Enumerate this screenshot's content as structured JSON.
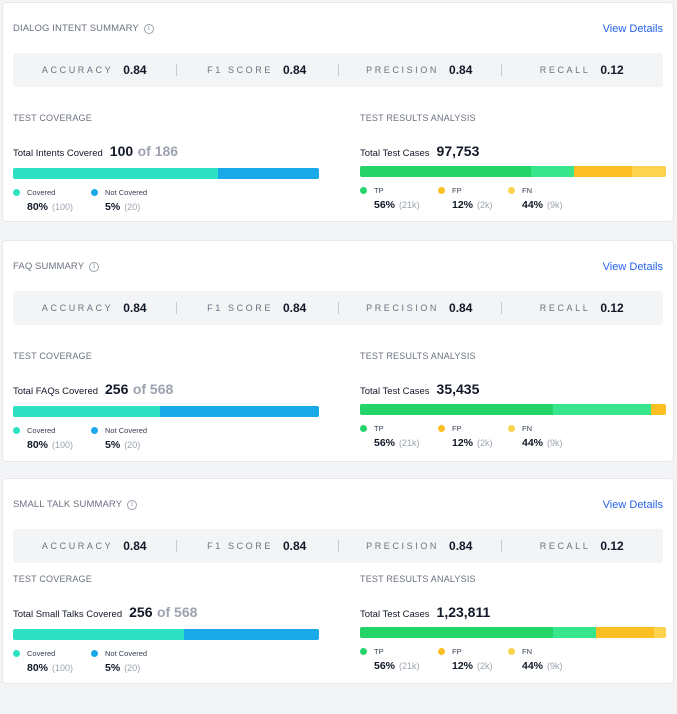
{
  "colors": {
    "covered": "#2de2c3",
    "not_covered": "#1aa9e8",
    "tp_dark": "#24d468",
    "tp_light": "#39e58a",
    "fp": "#fbbf24",
    "fn": "#fcd34d",
    "link": "#2563eb"
  },
  "cards": [
    {
      "title": "DIALOG INTENT SUMMARY",
      "view_details": "View Details",
      "metrics": [
        {
          "label": "ACCURACY",
          "value": "0.84"
        },
        {
          "label": "F1 SCORE",
          "value": "0.84"
        },
        {
          "label": "PRECISION",
          "value": "0.84"
        },
        {
          "label": "RECALL",
          "value": "0.12"
        }
      ],
      "coverage": {
        "title": "TEST COVERAGE",
        "total_label": "Total Intents Covered",
        "total_value": "100",
        "total_of": "of 186",
        "bar": [
          0.67,
          0.33
        ],
        "legend": [
          {
            "label": "Covered",
            "value": "80%",
            "sub": "(100)",
            "color": "#2de2c3"
          },
          {
            "label": "Not Covered",
            "value": "5%",
            "sub": "(20)",
            "color": "#1aa9e8"
          }
        ]
      },
      "results": {
        "title": "TEST RESULTS ANALYSIS",
        "total_label": "Total Test Cases",
        "total_value": "97,753",
        "bar": [
          0.56,
          0.14,
          0.19,
          0.11
        ],
        "legend": [
          {
            "label": "TP",
            "value": "56%",
            "sub": "(21k)",
            "color": "#24d468"
          },
          {
            "label": "FP",
            "value": "12%",
            "sub": "(2k)",
            "color": "#fbbf24"
          },
          {
            "label": "FN",
            "value": "44%",
            "sub": "(9k)",
            "color": "#fcd34d"
          }
        ]
      }
    },
    {
      "title": "FAQ SUMMARY",
      "view_details": "View Details",
      "metrics": [
        {
          "label": "ACCURACY",
          "value": "0.84"
        },
        {
          "label": "F1 SCORE",
          "value": "0.84"
        },
        {
          "label": "PRECISION",
          "value": "0.84"
        },
        {
          "label": "RECALL",
          "value": "0.12"
        }
      ],
      "coverage": {
        "title": "TEST COVERAGE",
        "total_label": "Total FAQs Covered",
        "total_value": "256",
        "total_of": "of 568",
        "bar": [
          0.48,
          0.52
        ],
        "legend": [
          {
            "label": "Covered",
            "value": "80%",
            "sub": "(100)",
            "color": "#2de2c3"
          },
          {
            "label": "Not Covered",
            "value": "5%",
            "sub": "(20)",
            "color": "#1aa9e8"
          }
        ]
      },
      "results": {
        "title": "TEST RESULTS ANALYSIS",
        "total_label": "Total Test Cases",
        "total_value": "35,435",
        "bar": [
          0.63,
          0.32,
          0.05,
          0.0
        ],
        "legend": [
          {
            "label": "TP",
            "value": "56%",
            "sub": "(21k)",
            "color": "#24d468"
          },
          {
            "label": "FP",
            "value": "12%",
            "sub": "(2k)",
            "color": "#fbbf24"
          },
          {
            "label": "FN",
            "value": "44%",
            "sub": "(9k)",
            "color": "#fcd34d"
          }
        ]
      }
    },
    {
      "title": "SMALL TALK SUMMARY",
      "view_details": "View Details",
      "metrics": [
        {
          "label": "ACCURACY",
          "value": "0.84"
        },
        {
          "label": "F1 SCORE",
          "value": "0.84"
        },
        {
          "label": "PRECISION",
          "value": "0.84"
        },
        {
          "label": "RECALL",
          "value": "0.12"
        }
      ],
      "coverage": {
        "title": "TEST COVERAGE",
        "total_label": "Total Small Talks Covered",
        "total_value": "256",
        "total_of": "of 568",
        "bar": [
          0.56,
          0.44
        ],
        "legend": [
          {
            "label": "Covered",
            "value": "80%",
            "sub": "(100)",
            "color": "#2de2c3"
          },
          {
            "label": "Not Covered",
            "value": "5%",
            "sub": "(20)",
            "color": "#1aa9e8"
          }
        ]
      },
      "results": {
        "title": "TEST RESULTS ANALYSIS",
        "total_label": "Total Test Cases",
        "total_value": "1,23,811",
        "bar": [
          0.63,
          0.14,
          0.19,
          0.04
        ],
        "legend": [
          {
            "label": "TP",
            "value": "56%",
            "sub": "(21k)",
            "color": "#24d468"
          },
          {
            "label": "FP",
            "value": "12%",
            "sub": "(2k)",
            "color": "#fbbf24"
          },
          {
            "label": "FN",
            "value": "44%",
            "sub": "(9k)",
            "color": "#fcd34d"
          }
        ]
      }
    }
  ]
}
